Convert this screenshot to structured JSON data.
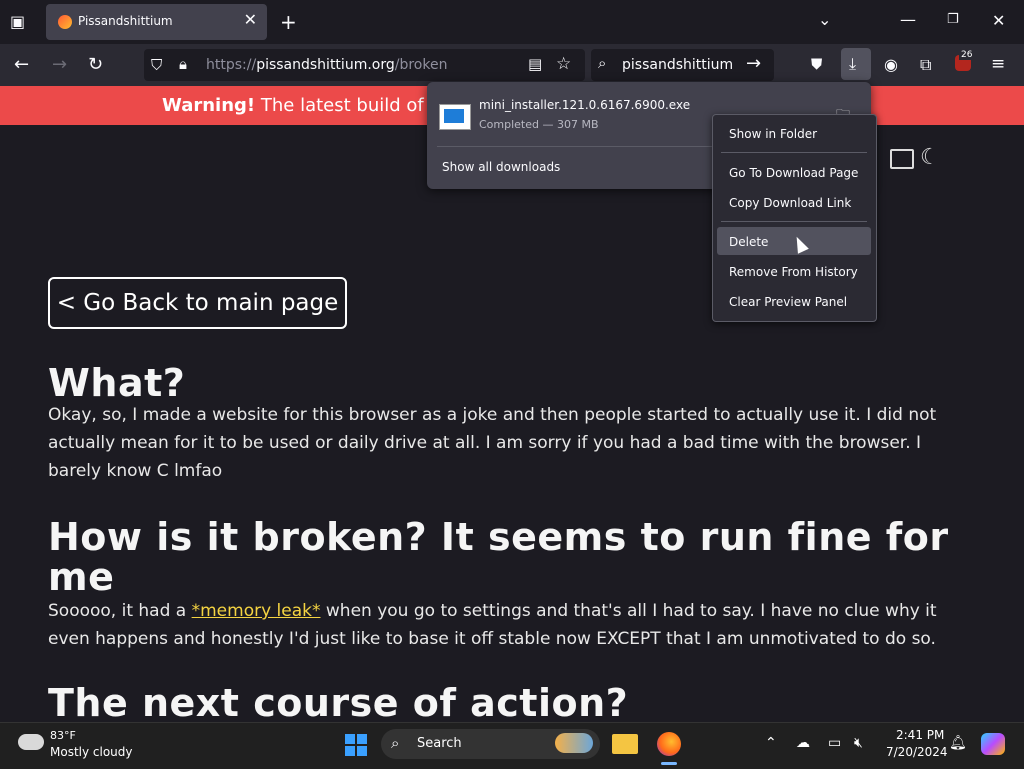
{
  "browser": {
    "tab": {
      "title": "Pissandshittium"
    },
    "url": {
      "prefix": "https://",
      "host": "pissandshittium.org",
      "path": "/broken"
    },
    "search_text": "pissandshittium",
    "extensions_badge": "26"
  },
  "banner": {
    "strong": "Warning!",
    "text": "The latest build of Pis"
  },
  "page": {
    "back_button": "< Go Back to main page",
    "h_what": "What?",
    "p_what": "Okay, so, I made a website for this browser as a joke and then people started to actually use it. I did not actually mean for it to be used or daily drive at all. I am sorry if you had a bad time with the browser. I barely know C lmfao",
    "h_broken": "How is it broken? It seems to run fine for me",
    "p_broken_pre": "Sooooo, it had a ",
    "p_broken_link": "*memory leak*",
    "p_broken_post": " when you go to settings and that's all I had to say. I have no clue why it even happens and honestly I'd just like to base it off stable now EXCEPT that I am unmotivated to do so.",
    "h_next": "The next course of action?"
  },
  "downloads": {
    "filename": "mini_installer.121.0.6167.6900.exe",
    "status": "Completed — 307 MB",
    "show_all": "Show all downloads"
  },
  "context_menu": {
    "show_in_folder": "Show in Folder",
    "go_to_page": "Go To Download Page",
    "copy_link": "Copy Download Link",
    "delete": "Delete",
    "remove_history": "Remove From History",
    "clear_preview": "Clear Preview Panel"
  },
  "taskbar": {
    "weather_temp": "83°F",
    "weather_desc": "Mostly cloudy",
    "search_label": "Search",
    "time": "2:41 PM",
    "date": "7/20/2024"
  }
}
